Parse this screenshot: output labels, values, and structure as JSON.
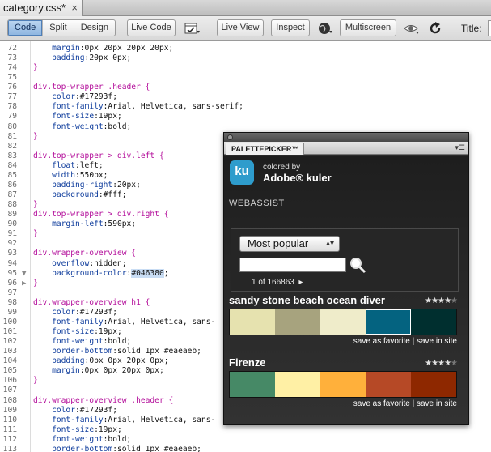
{
  "document_tab": {
    "label": "category.css*",
    "close": "×"
  },
  "toolbar": {
    "view_modes": [
      "Code",
      "Split",
      "Design"
    ],
    "active_view": "Code",
    "live_code_label": "Live Code",
    "live_view_label": "Live View",
    "inspect_label": "Inspect",
    "multiscreen_label": "Multiscreen",
    "title_label": "Title:"
  },
  "editor": {
    "lines": [
      {
        "n": "72",
        "code": [
          [
            "    ",
            ""
          ],
          [
            "margin",
            "prop"
          ],
          [
            ":0px 20px 20px 20px;",
            "val"
          ]
        ]
      },
      {
        "n": "73",
        "code": [
          [
            "    ",
            ""
          ],
          [
            "padding",
            "prop"
          ],
          [
            ":20px 0px;",
            "val"
          ]
        ]
      },
      {
        "n": "74",
        "code": [
          [
            "}",
            "punct"
          ]
        ]
      },
      {
        "n": "75",
        "code": []
      },
      {
        "n": "76",
        "code": [
          [
            "div.top-wrapper .header {",
            "sel"
          ]
        ]
      },
      {
        "n": "77",
        "code": [
          [
            "    ",
            ""
          ],
          [
            "color",
            "prop"
          ],
          [
            ":#17293f;",
            "val"
          ]
        ]
      },
      {
        "n": "78",
        "code": [
          [
            "    ",
            ""
          ],
          [
            "font-family",
            "prop"
          ],
          [
            ":Arial, Helvetica, sans-serif;",
            "val"
          ]
        ]
      },
      {
        "n": "79",
        "code": [
          [
            "    ",
            ""
          ],
          [
            "font-size",
            "prop"
          ],
          [
            ":19px;",
            "val"
          ]
        ]
      },
      {
        "n": "80",
        "code": [
          [
            "    ",
            ""
          ],
          [
            "font-weight",
            "prop"
          ],
          [
            ":bold;",
            "val"
          ]
        ]
      },
      {
        "n": "81",
        "code": [
          [
            "}",
            "punct"
          ]
        ]
      },
      {
        "n": "82",
        "code": []
      },
      {
        "n": "83",
        "code": [
          [
            "div.top-wrapper > div.left {",
            "sel"
          ]
        ]
      },
      {
        "n": "84",
        "code": [
          [
            "    ",
            ""
          ],
          [
            "float",
            "prop"
          ],
          [
            ":left;",
            "val"
          ]
        ]
      },
      {
        "n": "85",
        "code": [
          [
            "    ",
            ""
          ],
          [
            "width",
            "prop"
          ],
          [
            ":550px;",
            "val"
          ]
        ]
      },
      {
        "n": "86",
        "code": [
          [
            "    ",
            ""
          ],
          [
            "padding-right",
            "prop"
          ],
          [
            ":20px;",
            "val"
          ]
        ]
      },
      {
        "n": "87",
        "code": [
          [
            "    ",
            ""
          ],
          [
            "background",
            "prop"
          ],
          [
            ":#fff;",
            "val"
          ]
        ]
      },
      {
        "n": "88",
        "code": [
          [
            "}",
            "punct"
          ]
        ]
      },
      {
        "n": "89",
        "code": [
          [
            "div.top-wrapper > div.right {",
            "sel"
          ]
        ]
      },
      {
        "n": "90",
        "code": [
          [
            "    ",
            ""
          ],
          [
            "margin-left",
            "prop"
          ],
          [
            ":590px;",
            "val"
          ]
        ]
      },
      {
        "n": "91",
        "code": [
          [
            "}",
            "punct"
          ]
        ]
      },
      {
        "n": "92",
        "code": []
      },
      {
        "n": "93",
        "code": [
          [
            "div.wrapper-overview {",
            "sel"
          ]
        ]
      },
      {
        "n": "94",
        "code": [
          [
            "    ",
            ""
          ],
          [
            "overflow",
            "prop"
          ],
          [
            ":hidden;",
            "val"
          ]
        ]
      },
      {
        "n": "95",
        "code": [
          [
            "    ",
            ""
          ],
          [
            "background-color",
            "prop"
          ],
          [
            ":",
            "val"
          ],
          [
            "#046380",
            "hl"
          ],
          [
            ";",
            "val"
          ]
        ],
        "fold": "▼"
      },
      {
        "n": "96",
        "code": [
          [
            "}",
            "punct"
          ]
        ],
        "fold": "▶"
      },
      {
        "n": "97",
        "code": []
      },
      {
        "n": "98",
        "code": [
          [
            "div.wrapper-overview h1 {",
            "sel"
          ]
        ]
      },
      {
        "n": "99",
        "code": [
          [
            "    ",
            ""
          ],
          [
            "color",
            "prop"
          ],
          [
            ":#17293f;",
            "val"
          ]
        ]
      },
      {
        "n": "100",
        "code": [
          [
            "    ",
            ""
          ],
          [
            "font-family",
            "prop"
          ],
          [
            ":Arial, Helvetica, sans-",
            "val"
          ]
        ]
      },
      {
        "n": "101",
        "code": [
          [
            "    ",
            ""
          ],
          [
            "font-size",
            "prop"
          ],
          [
            ":19px;",
            "val"
          ]
        ]
      },
      {
        "n": "102",
        "code": [
          [
            "    ",
            ""
          ],
          [
            "font-weight",
            "prop"
          ],
          [
            ":bold;",
            "val"
          ]
        ]
      },
      {
        "n": "103",
        "code": [
          [
            "    ",
            ""
          ],
          [
            "border-bottom",
            "prop"
          ],
          [
            ":solid 1px #eaeaeb;",
            "val"
          ]
        ]
      },
      {
        "n": "104",
        "code": [
          [
            "    ",
            ""
          ],
          [
            "padding",
            "prop"
          ],
          [
            ":0px 0px 20px 0px;",
            "val"
          ]
        ]
      },
      {
        "n": "105",
        "code": [
          [
            "    ",
            ""
          ],
          [
            "margin",
            "prop"
          ],
          [
            ":0px 0px 20px 0px;",
            "val"
          ]
        ]
      },
      {
        "n": "106",
        "code": [
          [
            "}",
            "punct"
          ]
        ]
      },
      {
        "n": "107",
        "code": []
      },
      {
        "n": "108",
        "code": [
          [
            "div.wrapper-overview .header {",
            "sel"
          ]
        ]
      },
      {
        "n": "109",
        "code": [
          [
            "    ",
            ""
          ],
          [
            "color",
            "prop"
          ],
          [
            ":#17293f;",
            "val"
          ]
        ]
      },
      {
        "n": "110",
        "code": [
          [
            "    ",
            ""
          ],
          [
            "font-family",
            "prop"
          ],
          [
            ":Arial, Helvetica, sans-",
            "val"
          ]
        ]
      },
      {
        "n": "111",
        "code": [
          [
            "    ",
            ""
          ],
          [
            "font-size",
            "prop"
          ],
          [
            ":19px;",
            "val"
          ]
        ]
      },
      {
        "n": "112",
        "code": [
          [
            "    ",
            ""
          ],
          [
            "font-weight",
            "prop"
          ],
          [
            ":bold;",
            "val"
          ]
        ]
      },
      {
        "n": "113",
        "code": [
          [
            "    ",
            ""
          ],
          [
            "border-bottom",
            "prop"
          ],
          [
            ":solid 1px #eaeaeb;",
            "val"
          ]
        ]
      }
    ]
  },
  "palette_panel": {
    "tab_label": "PALETTEPICKER™",
    "logo_text": "ku",
    "colored_by": "colored by",
    "brand": "Adobe® kuler",
    "webassist": "WEBASSIST",
    "sort_select": "Most popular",
    "search_value": "",
    "pager": "1 of 166863",
    "action_favorite": "save as favorite",
    "action_separator": " | ",
    "action_site": "save in site",
    "themes": [
      {
        "name": "sandy stone beach ocean diver",
        "rating": 4,
        "colors": [
          "#e6e2af",
          "#a7a37e",
          "#efecca",
          "#046380",
          "#002f2f"
        ],
        "selected_index": 3
      },
      {
        "name": "Firenze",
        "rating": 4,
        "colors": [
          "#468966",
          "#fff0a5",
          "#ffb03b",
          "#b64926",
          "#8e2800"
        ],
        "selected_index": -1
      }
    ]
  }
}
